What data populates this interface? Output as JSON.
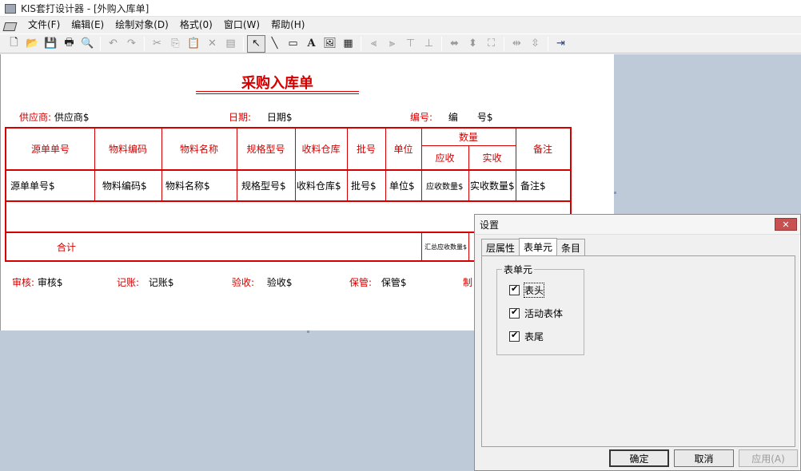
{
  "window": {
    "title": "KIS套打设计器 - [外购入库单]"
  },
  "menu": [
    "文件(F)",
    "编辑(E)",
    "绘制对象(D)",
    "格式(0)",
    "窗口(W)",
    "帮助(H)"
  ],
  "toolbar": {
    "buttons": [
      "new-icon",
      "open-icon",
      "save-icon",
      "print-icon",
      "print-preview-icon",
      "undo-icon",
      "redo-icon",
      "cut-icon",
      "copy-icon",
      "paste-icon",
      "delete-icon",
      "clear-icon",
      "select-arrow-icon",
      "line-icon",
      "rectangle-icon",
      "text-icon",
      "image-icon",
      "barcode-icon",
      "align-left-icon",
      "align-right-icon",
      "align-top-icon",
      "align-bottom-icon",
      "same-width-icon",
      "same-height-icon",
      "same-size-icon",
      "h-space-icon",
      "v-space-icon",
      "exit-icon"
    ]
  },
  "document": {
    "title": "采购入库单",
    "header": {
      "supplier_label": "供应商:",
      "supplier_value": "供应商$",
      "date_label": "日期:",
      "date_value": "日期$",
      "number_label": "编号:",
      "number_value": "编　　号$"
    },
    "table": {
      "headers": {
        "source_no": "源单单号",
        "item_code": "物料编码",
        "item_name": "物料名称",
        "spec": "规格型号",
        "warehouse": "收料仓库",
        "batch": "批号",
        "unit": "单位",
        "qty": "数量",
        "qty_due": "应收",
        "qty_actual": "实收",
        "remark": "备注"
      },
      "row": {
        "source_no": "源单单号$",
        "item_code": "物料编码$",
        "item_name": "物料名称$",
        "spec": "规格型号$",
        "warehouse": "收料仓库$",
        "batch": "批号$",
        "unit": "单位$",
        "qty_due": "应收数量$",
        "qty_actual": "实收数量$",
        "remark": "备注$"
      },
      "total_label": "合计",
      "total_due": "汇总应收数量$"
    },
    "footer": {
      "audit_label": "审核:",
      "audit_value": "审核$",
      "post_label": "记账:",
      "post_value": "记账$",
      "check_label": "验收:",
      "check_value": "验收$",
      "keeper_label": "保管:",
      "keeper_value": "保管$",
      "maker_label": "制"
    }
  },
  "dialog": {
    "title": "设置",
    "close": "✕",
    "tabs": [
      "层属性",
      "表单元",
      "条目"
    ],
    "active_tab": "表单元",
    "group_label": "表单元",
    "checkboxes": [
      {
        "label": "表头",
        "checked": true
      },
      {
        "label": "活动表体",
        "checked": true
      },
      {
        "label": "表尾",
        "checked": true
      }
    ],
    "buttons": {
      "ok": "确定",
      "cancel": "取消",
      "apply": "应用(A)"
    }
  }
}
